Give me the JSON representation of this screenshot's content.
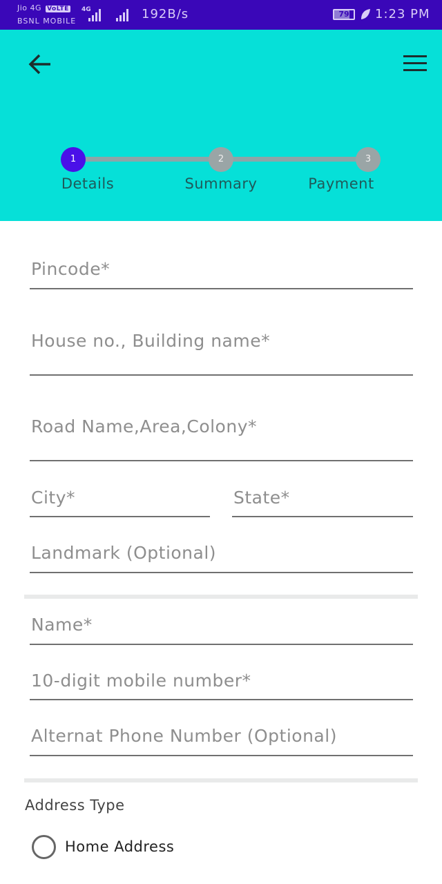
{
  "status_bar": {
    "carrier1": "Jio 4G",
    "volte": "VoLTE",
    "carrier2": "BSNL MOBILE",
    "network_type": "4G",
    "net_speed": "192B/s",
    "battery_level": "79",
    "time": "1:23 PM"
  },
  "header": {
    "back_icon": "arrow-left-icon",
    "menu_icon": "hamburger-menu-icon",
    "steps": [
      {
        "number": "1",
        "label": "Details",
        "active": true
      },
      {
        "number": "2",
        "label": "Summary",
        "active": false
      },
      {
        "number": "3",
        "label": "Payment",
        "active": false
      }
    ]
  },
  "form": {
    "pincode": {
      "placeholder": "Pincode*",
      "value": ""
    },
    "house": {
      "placeholder": "House no., Building name*",
      "value": ""
    },
    "road": {
      "placeholder": "Road Name,Area,Colony*",
      "value": ""
    },
    "city": {
      "placeholder": "City*",
      "value": ""
    },
    "state": {
      "placeholder": "State*",
      "value": ""
    },
    "landmark": {
      "placeholder": "Landmark (Optional)",
      "value": ""
    },
    "name": {
      "placeholder": "Name*",
      "value": ""
    },
    "mobile": {
      "placeholder": "10-digit mobile number*",
      "value": ""
    },
    "alt_phone": {
      "placeholder": "Alternat Phone Number (Optional)",
      "value": ""
    }
  },
  "address_type": {
    "title": "Address Type",
    "options": [
      {
        "label": "Home Address",
        "selected": false
      }
    ]
  },
  "colors": {
    "status_bar": "#3a07b8",
    "header": "#06e0d8",
    "active_step": "#4a10e8",
    "inactive_step": "#9aa5a6"
  }
}
